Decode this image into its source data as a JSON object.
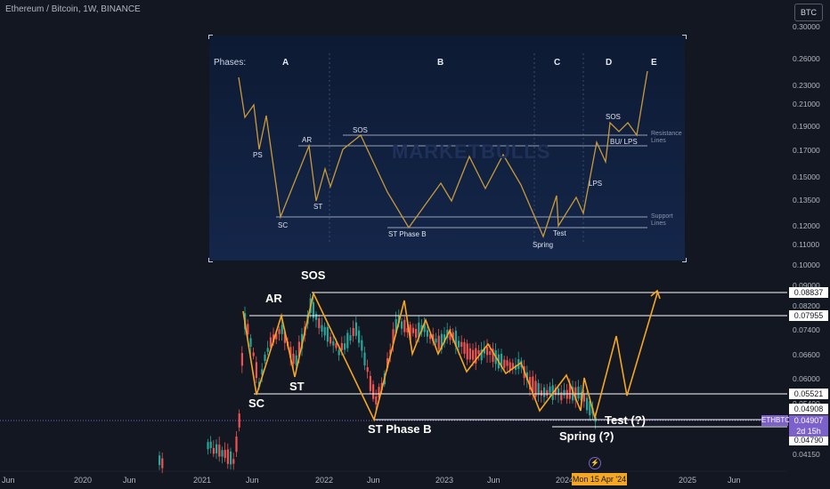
{
  "header": {
    "title": "Ethereum / Bitcoin, 1W, BINANCE",
    "currency_button": "BTC"
  },
  "price_axis": {
    "ticks": [
      "0.30000",
      "0.26000",
      "0.23000",
      "0.21000",
      "0.19000",
      "0.17000",
      "0.15000",
      "0.13500",
      "0.12000",
      "0.11000",
      "0.10000",
      "0.09000",
      "0.08200",
      "0.07400",
      "0.06600",
      "0.06000",
      "0.05400",
      "0.04908",
      "0.04790",
      "0.04150"
    ],
    "marked_levels": [
      "0.08837",
      "0.07955",
      "0.05521",
      "0.04908",
      "0.04790"
    ],
    "last_price_label": {
      "symbol": "ETHBTC",
      "price": "0.04907",
      "countdown": "2d 15h",
      "color": "#7b61c9"
    }
  },
  "time_axis": {
    "ticks": [
      "Jun",
      "2020",
      "Jun",
      "2021",
      "Jun",
      "2022",
      "Jun",
      "2023",
      "Jun",
      "2024",
      "Jun",
      "2025",
      "Jun"
    ],
    "crosshair_label": "Mon 15 Apr '24",
    "crosshair_color": "#f5a623"
  },
  "inset": {
    "phases_label": "Phases:",
    "phases": [
      "A",
      "B",
      "C",
      "D",
      "E"
    ],
    "labels": {
      "ps": "PS",
      "sc": "SC",
      "ar": "AR",
      "st": "ST",
      "sos1": "SOS",
      "st_phase_b": "ST Phase B",
      "spring": "Spring",
      "test": "Test",
      "lps": "LPS",
      "sos2": "SOS",
      "bu_lps": "BU/ LPS"
    },
    "resistance_label": [
      "Resistance",
      "Lines"
    ],
    "support_label": [
      "Support",
      "Lines"
    ],
    "watermark": "MARKETBULLS"
  },
  "annotations": {
    "sos": "SOS",
    "ar": "AR",
    "st": "ST",
    "sc": "SC",
    "st_phase_b": "ST Phase B",
    "spring": "Spring (?)",
    "test": "Test (?)"
  },
  "colors": {
    "background": "#131722",
    "up_candle": "#26a69a",
    "down_candle": "#ef5350",
    "wave": "#f5a623",
    "level_line": "#ffffff",
    "inset_bg": "#0f1f3d"
  }
}
